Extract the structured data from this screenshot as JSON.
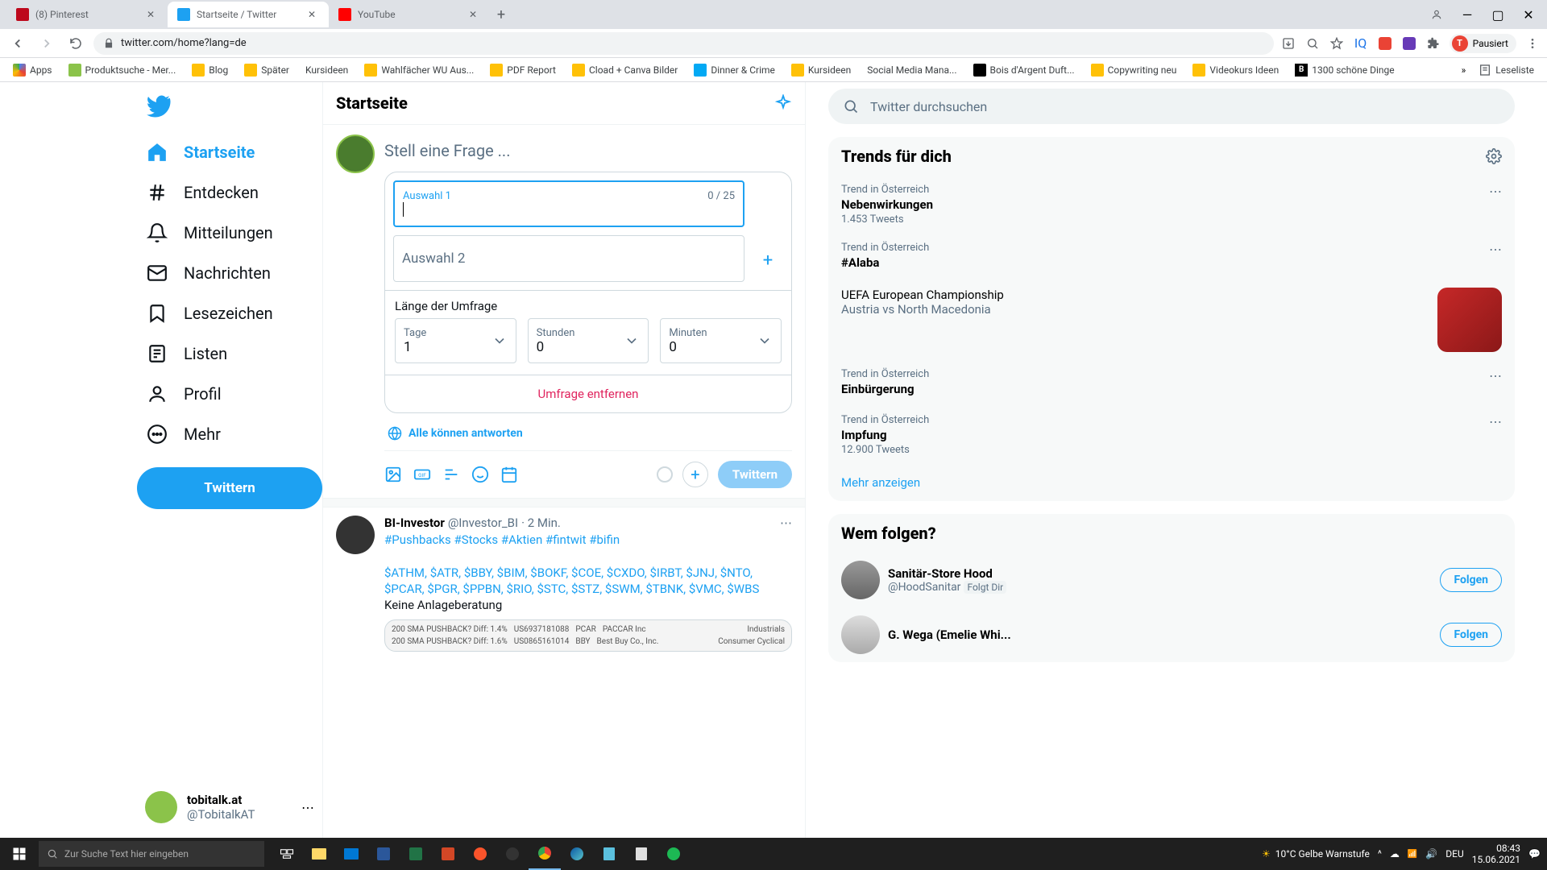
{
  "browser": {
    "tabs": [
      {
        "title": "(8) Pinterest",
        "active": false,
        "favicon": "#bd081c"
      },
      {
        "title": "Startseite / Twitter",
        "active": true,
        "favicon": "#1da1f2"
      },
      {
        "title": "YouTube",
        "active": false,
        "favicon": "#ff0000"
      }
    ],
    "url": "twitter.com/home?lang=de",
    "profile_status": "Pausiert",
    "profile_letter": "T",
    "bookmarks": [
      "Apps",
      "Produktsuche - Mer...",
      "Blog",
      "Später",
      "Kursideen",
      "Wahlfächer WU Aus...",
      "PDF Report",
      "Cload + Canva Bilder",
      "Dinner & Crime",
      "Kursideen",
      "Social Media Mana...",
      "Bois d'Argent Duft...",
      "Copywriting neu",
      "Videokurs Ideen",
      "1300 schöne Dinge"
    ],
    "bookmarks_overflow": "Leseliste"
  },
  "sidebar": {
    "items": [
      {
        "label": "Startseite",
        "active": true
      },
      {
        "label": "Entdecken",
        "active": false
      },
      {
        "label": "Mitteilungen",
        "active": false
      },
      {
        "label": "Nachrichten",
        "active": false
      },
      {
        "label": "Lesezeichen",
        "active": false
      },
      {
        "label": "Listen",
        "active": false
      },
      {
        "label": "Profil",
        "active": false
      },
      {
        "label": "Mehr",
        "active": false
      }
    ],
    "tweet_button": "Twittern",
    "profile": {
      "name": "tobitalk.at",
      "handle": "@TobitalkAT"
    }
  },
  "main": {
    "header": "Startseite",
    "compose": {
      "placeholder": "Stell eine Frage ...",
      "poll": {
        "choice1": {
          "label": "Auswahl 1",
          "counter": "0 / 25"
        },
        "choice2": {
          "label": "Auswahl 2"
        },
        "duration_label": "Länge der Umfrage",
        "days": {
          "label": "Tage",
          "value": "1"
        },
        "hours": {
          "label": "Stunden",
          "value": "0"
        },
        "minutes": {
          "label": "Minuten",
          "value": "0"
        },
        "remove": "Umfrage entfernen"
      },
      "reply_permission": "Alle können antworten",
      "submit": "Twittern"
    },
    "feed_tweet": {
      "username": "BI-Investor",
      "handle": "@Investor_BI",
      "time": "· 2 Min.",
      "hashtags": "#Pushbacks #Stocks #Aktien #fintwit #bifin",
      "tickers_line1": "$ATHM, $ATR, $BBY, $BIM, $BOKF, $COE, $CXDO, $IRBT, $JNJ, $NTO,",
      "tickers_line2": "$PCAR, $PGR, $PPBN, $RIO, $STC, $STZ, $SWM, $TBNK, $VMC, $WBS",
      "disclaimer": "Keine Anlageberatung",
      "table_rows": [
        {
          "c1": "200 SMA PUSHBACK? Diff: 1.4%",
          "c2": "US6937181088",
          "c3": "PCAR",
          "c4": "PACCAR Inc",
          "c5": "Industrials"
        },
        {
          "c1": "200 SMA PUSHBACK? Diff: 1.6%",
          "c2": "US0865161014",
          "c3": "BBY",
          "c4": "Best Buy Co., Inc.",
          "c5": "Consumer Cyclical"
        }
      ]
    }
  },
  "right": {
    "search_placeholder": "Twitter durchsuchen",
    "trends_header": "Trends für dich",
    "trends": [
      {
        "location": "Trend in Österreich",
        "topic": "Nebenwirkungen",
        "count": "1.453 Tweets"
      },
      {
        "location": "Trend in Österreich",
        "topic": "#Alaba",
        "count": ""
      }
    ],
    "trend_event": {
      "title": "UEFA European Championship",
      "subtitle": "Austria vs North Macedonia"
    },
    "trends2": [
      {
        "location": "Trend in Österreich",
        "topic": "Einbürgerung",
        "count": ""
      },
      {
        "location": "Trend in Österreich",
        "topic": "Impfung",
        "count": "12.900 Tweets"
      }
    ],
    "show_more": "Mehr anzeigen",
    "follow_header": "Wem folgen?",
    "follow": [
      {
        "name": "Sanitär-Store Hood",
        "handle": "@HoodSanitar",
        "follows_you": "Folgt Dir",
        "button": "Folgen"
      },
      {
        "name": "G. Wega (Emelie Whi...",
        "handle": "",
        "follows_you": "",
        "button": "Folgen"
      }
    ]
  },
  "taskbar": {
    "search_placeholder": "Zur Suche Text hier eingeben",
    "weather": "10°C  Gelbe Warnstufe",
    "lang": "DEU",
    "time": "08:43",
    "date": "15.06.2021"
  }
}
